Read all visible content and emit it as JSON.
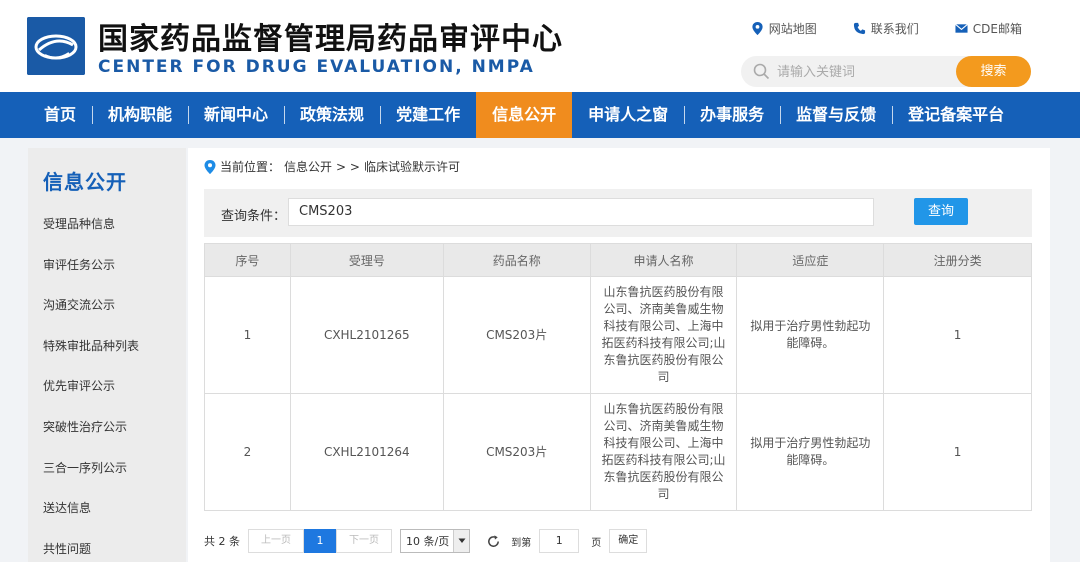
{
  "header": {
    "title_cn": "国家药品监督管理局药品审评中心",
    "title_en": "CENTER FOR DRUG EVALUATION, NMPA",
    "links": [
      {
        "label": "网站地图",
        "icon": "map-pin-icon"
      },
      {
        "label": "联系我们",
        "icon": "phone-icon"
      },
      {
        "label": "CDE邮箱",
        "icon": "mail-icon"
      }
    ],
    "search": {
      "placeholder": "请输入关键词",
      "button": "搜索"
    }
  },
  "colors": {
    "nav": "#1560b8",
    "nav_active": "#f08c1e",
    "search_button": "#f39a1e",
    "query_button": "#2196e8",
    "page_active": "#1e78e0"
  },
  "nav": {
    "items": [
      "首页",
      "机构职能",
      "新闻中心",
      "政策法规",
      "党建工作",
      "信息公开",
      "申请人之窗",
      "办事服务",
      "监督与反馈",
      "登记备案平台"
    ],
    "active": "信息公开"
  },
  "sidebar": {
    "title": "信息公开",
    "items": [
      "受理品种信息",
      "审评任务公示",
      "沟通交流公示",
      "特殊审批品种列表",
      "优先审评公示",
      "突破性治疗公示",
      "三合一序列公示",
      "送达信息",
      "共性问题"
    ]
  },
  "breadcrumb": {
    "prefix": "当前位置：",
    "path1": "信息公开",
    "sep": "> >",
    "path2": "临床试验默示许可"
  },
  "query": {
    "label": "查询条件：",
    "value": "CMS203",
    "button": "查询"
  },
  "table": {
    "headers": [
      "序号",
      "受理号",
      "药品名称",
      "申请人名称",
      "适应症",
      "注册分类"
    ],
    "rows": [
      {
        "no": "1",
        "accept_no": "CXHL2101265",
        "drug": "CMS203片",
        "applicant": "山东鲁抗医药股份有限公司、济南美鲁威生物科技有限公司、上海中拓医药科技有限公司;山东鲁抗医药股份有限公司",
        "indication": "拟用于治疗男性勃起功能障碍。",
        "category": "1"
      },
      {
        "no": "2",
        "accept_no": "CXHL2101264",
        "drug": "CMS203片",
        "applicant": "山东鲁抗医药股份有限公司、济南美鲁威生物科技有限公司、上海中拓医药科技有限公司;山东鲁抗医药股份有限公司",
        "indication": "拟用于治疗男性勃起功能障碍。",
        "category": "1"
      }
    ]
  },
  "pager": {
    "total": "共 2 条",
    "prev": "上一页",
    "current": "1",
    "next": "下一页",
    "page_size": "10 条/页",
    "goto": "到第",
    "goto_value": "1",
    "page_unit": "页",
    "confirm": "确定"
  }
}
